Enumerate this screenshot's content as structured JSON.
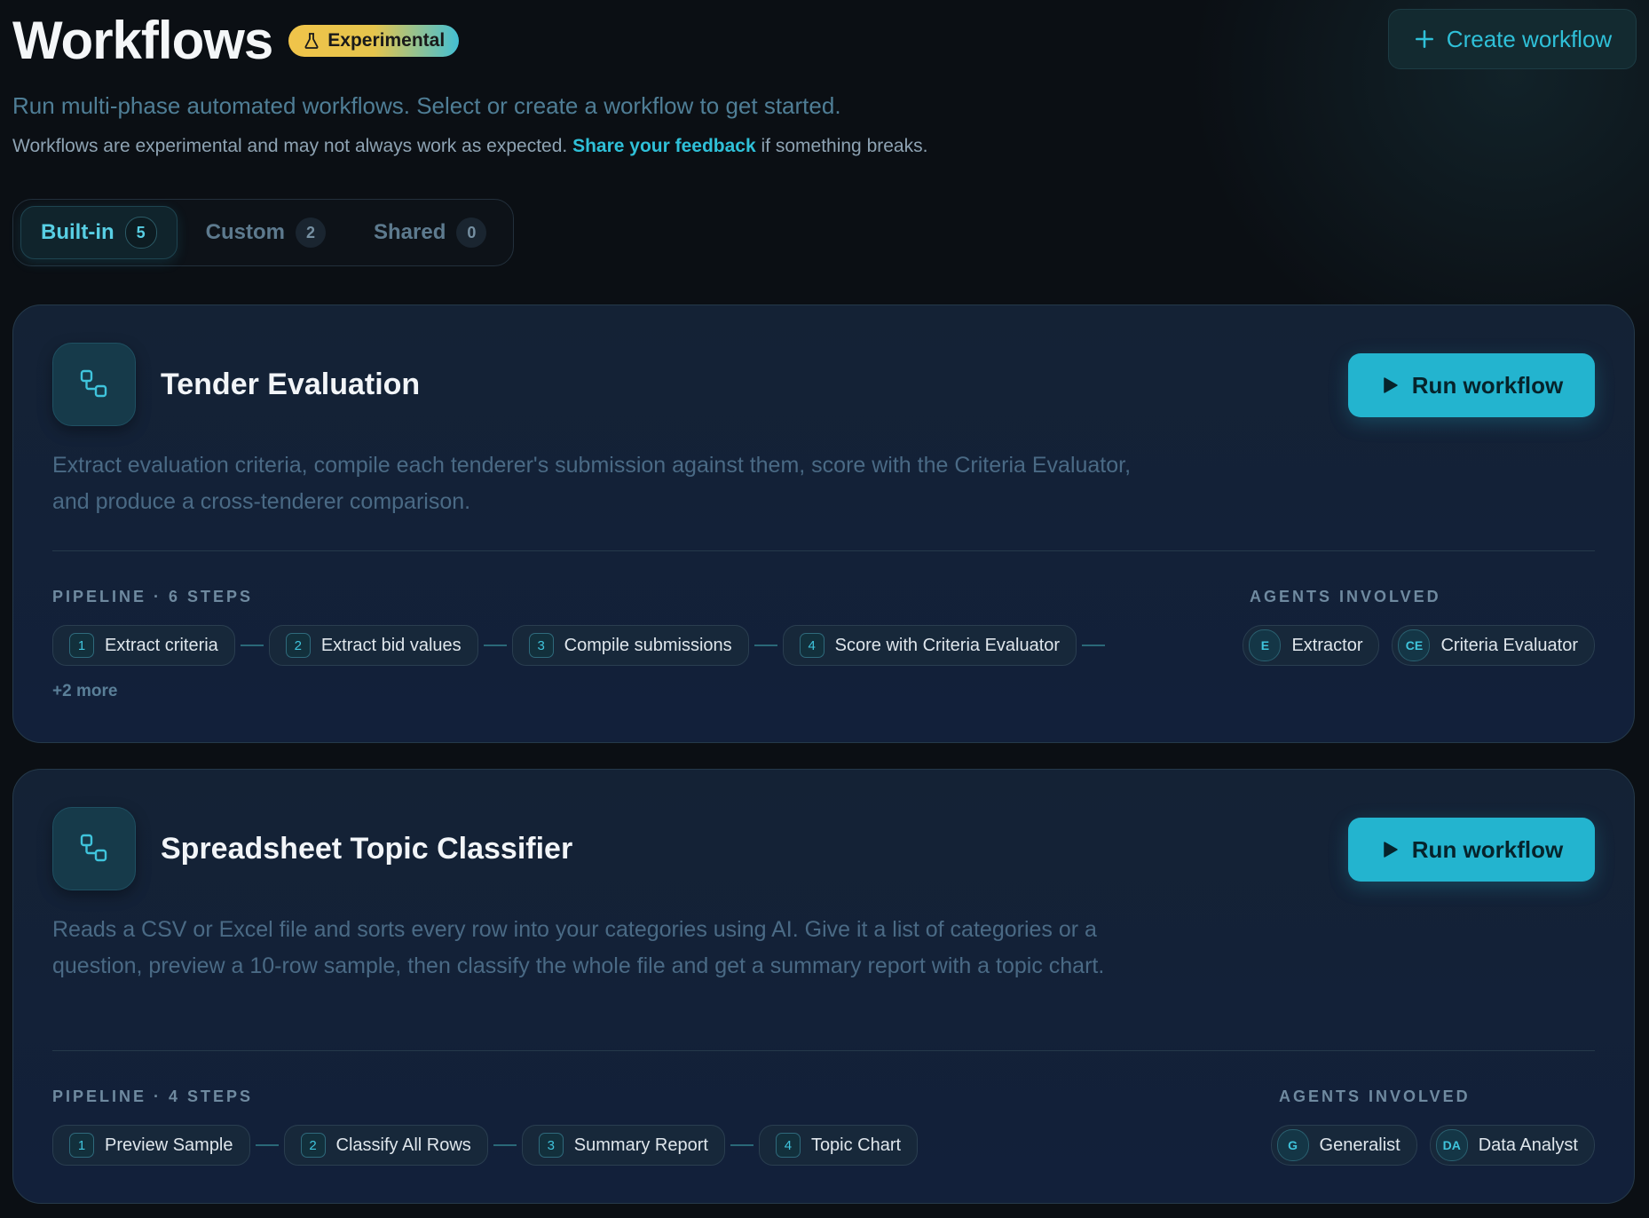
{
  "header": {
    "title": "Workflows",
    "badge": "Experimental",
    "create_label": "Create workflow",
    "subtitle": "Run multi-phase automated workflows. Select or create a workflow to get started.",
    "note_before": "Workflows are experimental and may not always work as expected.",
    "note_link": "Share your feedback",
    "note_after": "if something breaks."
  },
  "tabs": [
    {
      "label": "Built-in",
      "count": "5",
      "active": true
    },
    {
      "label": "Custom",
      "count": "2",
      "active": false
    },
    {
      "label": "Shared",
      "count": "0",
      "active": false
    }
  ],
  "cards": [
    {
      "title": "Tender Evaluation",
      "run_label": "Run workflow",
      "description": "Extract evaluation criteria, compile each tenderer's submission against them, score with the Criteria Evaluator, and produce a cross-tenderer comparison.",
      "pipeline_label": "PIPELINE · 6 STEPS",
      "steps": [
        {
          "num": "1",
          "label": "Extract criteria"
        },
        {
          "num": "2",
          "label": "Extract bid values"
        },
        {
          "num": "3",
          "label": "Compile submissions"
        },
        {
          "num": "4",
          "label": "Score with Criteria Evaluator"
        }
      ],
      "more": "+2 more",
      "agents_label": "AGENTS INVOLVED",
      "agents": [
        {
          "initials": "E",
          "name": "Extractor"
        },
        {
          "initials": "CE",
          "name": "Criteria Evaluator"
        }
      ]
    },
    {
      "title": "Spreadsheet Topic Classifier",
      "run_label": "Run workflow",
      "description": "Reads a CSV or Excel file and sorts every row into your categories using AI. Give it a list of categories or a question, preview a 10-row sample, then classify the whole file and get a summary report with a topic chart.",
      "pipeline_label": "PIPELINE · 4 STEPS",
      "steps": [
        {
          "num": "1",
          "label": "Preview Sample"
        },
        {
          "num": "2",
          "label": "Classify All Rows"
        },
        {
          "num": "3",
          "label": "Summary Report"
        },
        {
          "num": "4",
          "label": "Topic Chart"
        }
      ],
      "agents_label": "AGENTS INVOLVED",
      "agents": [
        {
          "initials": "G",
          "name": "Generalist"
        },
        {
          "initials": "DA",
          "name": "Data Analyst"
        }
      ]
    }
  ]
}
